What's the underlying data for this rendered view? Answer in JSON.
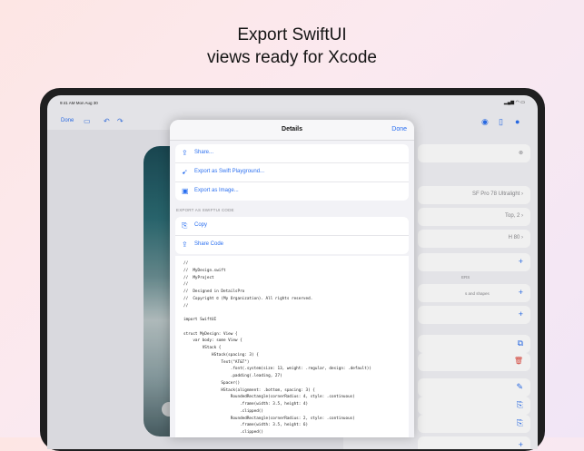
{
  "headline": {
    "line1": "Export SwiftUI",
    "line2": "views ready for Xcode"
  },
  "status_bar": {
    "time_date": "9:41 AM   Mon Aug 30",
    "indicators": "▂▄▆ ◠ ▭"
  },
  "toolbar": {
    "done_label": "Done"
  },
  "inspector": {
    "rows": [
      {
        "value": "SF Pro 78 Ultralight ›"
      },
      {
        "value": "Top, 2 ›"
      },
      {
        "value": "H 80 ›"
      }
    ],
    "caption_layers": "ERS",
    "caption_shapes": "s and shapes"
  },
  "details_sheet": {
    "title": "Details",
    "done_label": "Done",
    "actions": [
      {
        "label": "Share...",
        "icon": "share-icon"
      },
      {
        "label": "Export as Swift Playground...",
        "icon": "swift-icon"
      },
      {
        "label": "Export as Image...",
        "icon": "image-icon"
      }
    ],
    "section_title": "EXPORT AS SWIFTUI CODE",
    "code_actions": [
      {
        "label": "Copy",
        "icon": "copy-icon"
      },
      {
        "label": "Share Code",
        "icon": "share-icon"
      }
    ],
    "code_lines": [
      "//",
      "//  MyDesign.swift",
      "//  MyProject",
      "//",
      "//  Designed in DetailsPro",
      "//  Copyright © (My Organization). All rights reserved.",
      "//",
      "",
      "import SwiftUI",
      "",
      "struct MyDesign: View {",
      "    var body: some View {",
      "        VStack {",
      "            HStack(spacing: 3) {",
      "                Text(\"AT&T\")",
      "                    .font(.system(size: 13, weight: .regular, design: .default))",
      "                    .padding(.leading, 27)",
      "                Spacer()",
      "                HStack(alignment: .bottom, spacing: 3) {",
      "                    RoundedRectangle(cornerRadius: 4, style: .continuous)",
      "                        .frame(width: 3.5, height: 4)",
      "                        .clipped()",
      "                    RoundedRectangle(cornerRadius: 2, style: .continuous)",
      "                        .frame(width: 3.5, height: 6)",
      "                        .clipped()"
    ]
  },
  "colors": {
    "accent": "#2a6ff0",
    "destructive": "#e0453a",
    "device_frame": "#1f1f20"
  }
}
